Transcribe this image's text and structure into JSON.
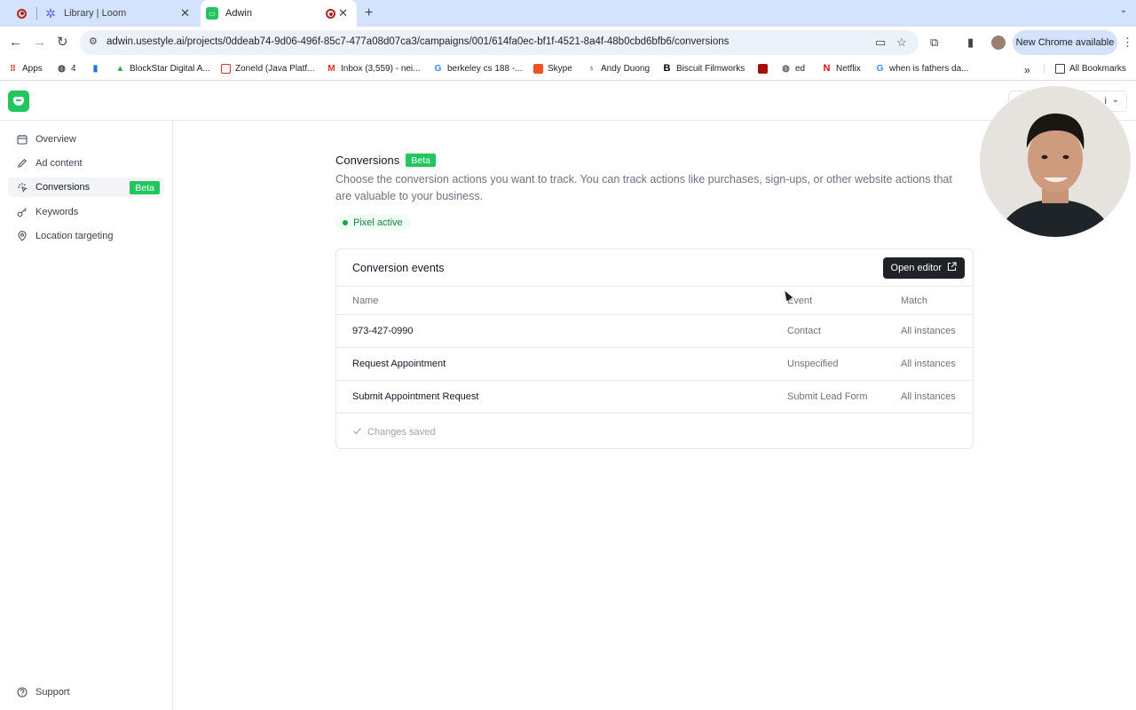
{
  "browser": {
    "tabs": [
      {
        "title": "",
        "icon": "recording-icon"
      },
      {
        "title": "Library | Loom",
        "icon": "loom-icon"
      },
      {
        "title": "Adwin",
        "icon": "adwin-icon",
        "active": true
      }
    ],
    "url": "adwin.usestyle.ai/projects/0ddeab74-9d06-496f-85c7-477a08d07ca3/campaigns/001/614fa0ec-bf1f-4521-8a4f-48b0cbd6bfb6/conversions",
    "new_chrome_label": "New Chrome available",
    "bookmarks": [
      {
        "label": "Apps"
      },
      {
        "label": "4"
      },
      {
        "label": ""
      },
      {
        "label": "BlockStar Digital A..."
      },
      {
        "label": "ZoneId (Java Platf..."
      },
      {
        "label": "Inbox (3,559) - nei..."
      },
      {
        "label": "berkeley cs 188 -..."
      },
      {
        "label": "Skype"
      },
      {
        "label": "Andy Duong"
      },
      {
        "label": "Biscuit Filmworks"
      },
      {
        "label": ""
      },
      {
        "label": "ed"
      },
      {
        "label": "Netflix"
      },
      {
        "label": "when is fathers da..."
      }
    ],
    "all_bookmarks_label": "All Bookmarks"
  },
  "sidebar": {
    "items": [
      {
        "label": "Overview",
        "icon": "calendar-icon"
      },
      {
        "label": "Ad content",
        "icon": "pencil-icon"
      },
      {
        "label": "Conversions",
        "icon": "sparkle-icon",
        "badge": "Beta",
        "active": true
      },
      {
        "label": "Keywords",
        "icon": "key-icon"
      },
      {
        "label": "Location targeting",
        "icon": "location-pin-icon"
      }
    ],
    "support_label": "Support",
    "project_select_label": "i"
  },
  "main": {
    "title": "Conversions",
    "title_badge": "Beta",
    "description": "Choose the conversion actions you want to track. You can track actions like purchases, sign-ups, or other website actions that are valuable to your business.",
    "pixel_status": "Pixel active",
    "card": {
      "title": "Conversion events",
      "open_editor_label": "Open editor",
      "columns": [
        "Name",
        "Event",
        "Match"
      ],
      "rows": [
        {
          "name": "973-427-0990",
          "event": "Contact",
          "match": "All instances"
        },
        {
          "name": "Request Appointment",
          "event": "Unspecified",
          "match": "All instances"
        },
        {
          "name": "Submit Appointment Request",
          "event": "Submit Lead Form",
          "match": "All instances"
        }
      ],
      "status": "Changes saved"
    }
  },
  "colors": {
    "accent_green": "#22c55e",
    "dark_button": "#1f2328",
    "chrome_tabstrip": "#d3e3fd"
  }
}
